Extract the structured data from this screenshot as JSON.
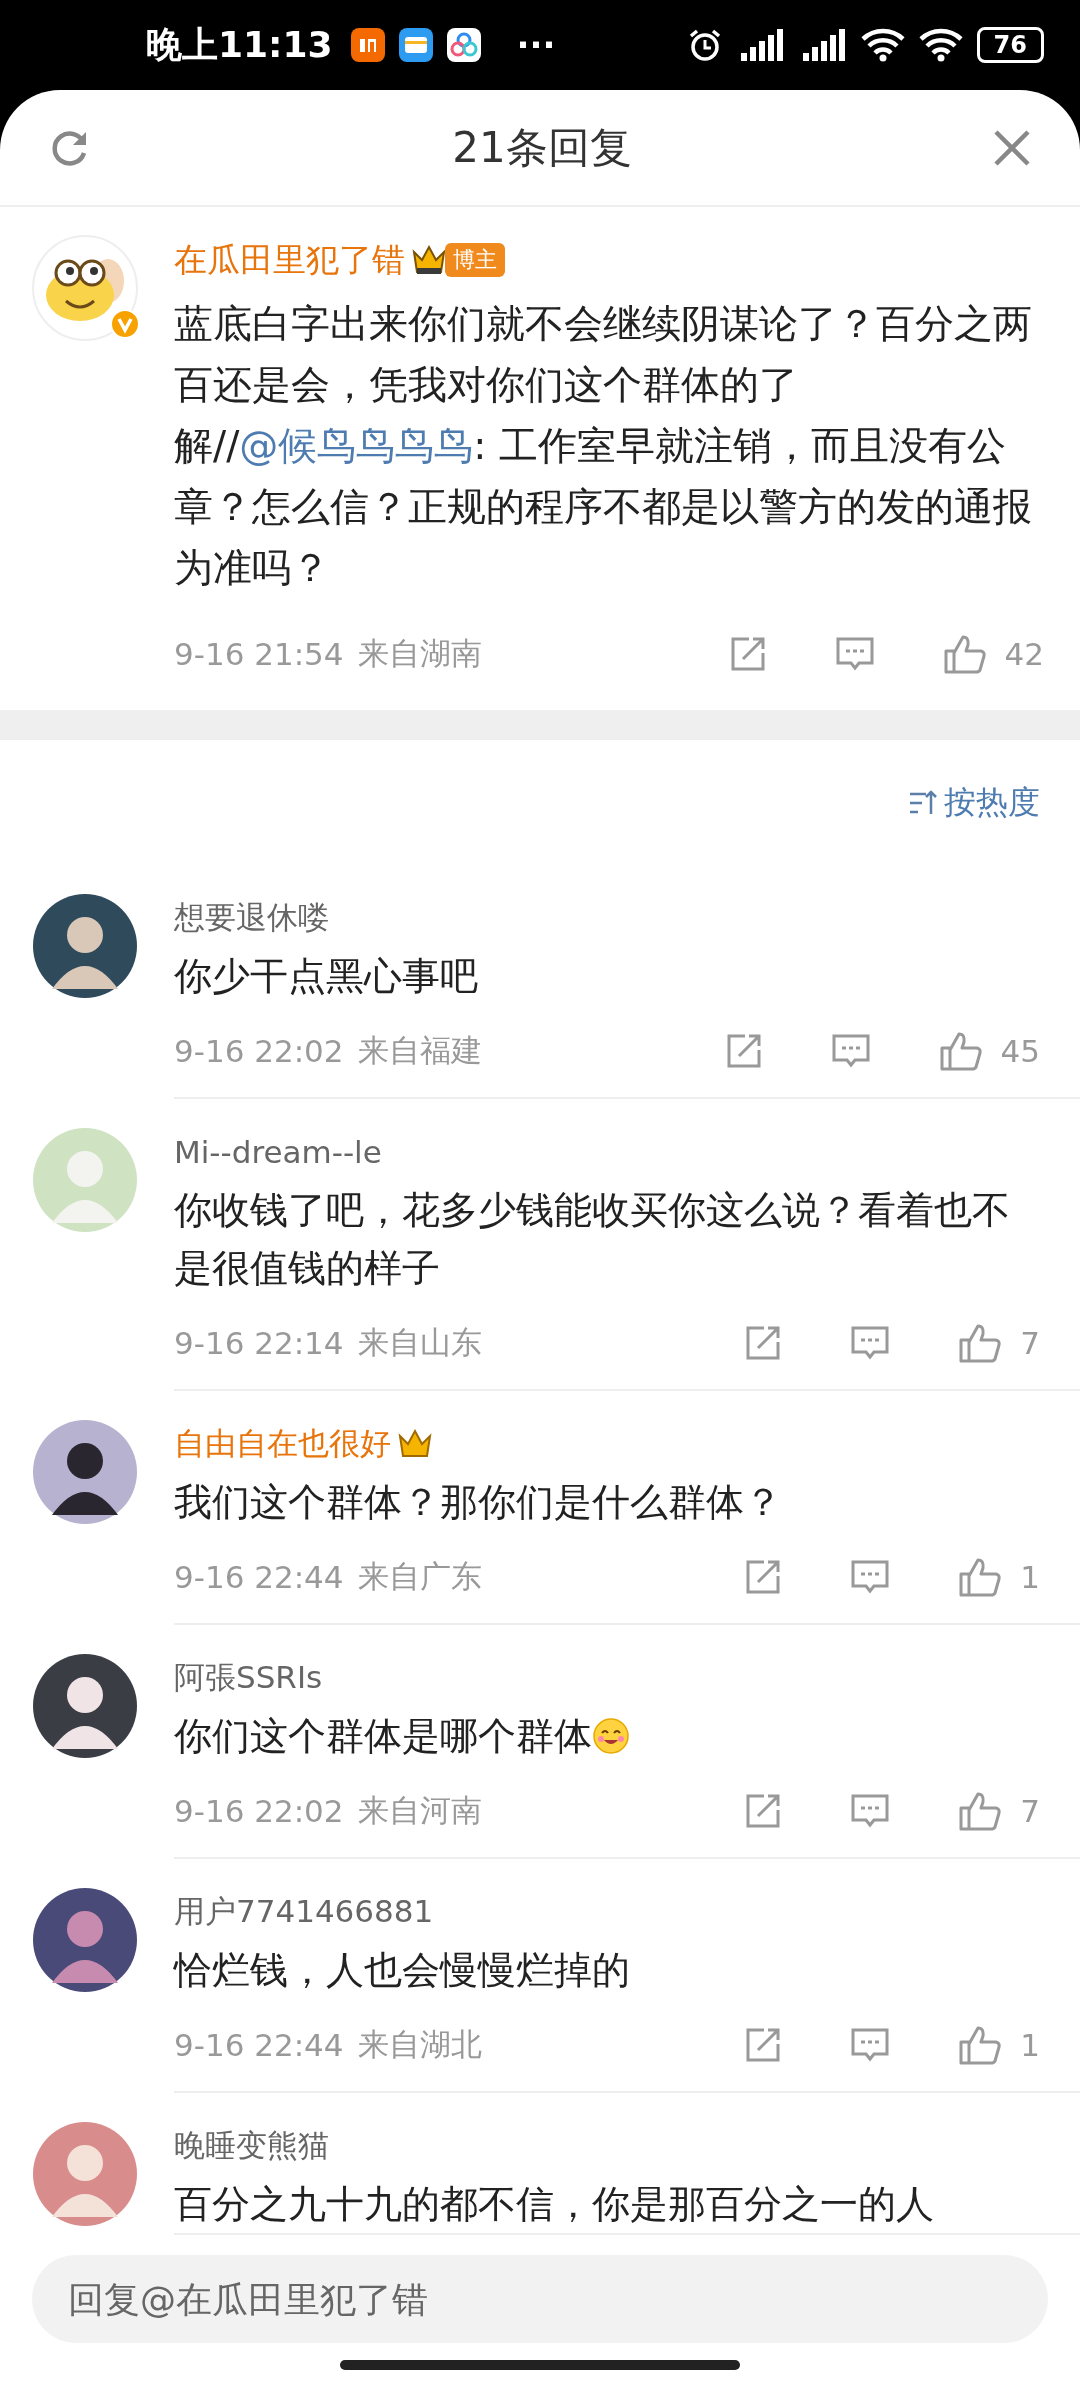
{
  "status_bar": {
    "time": "晚上11:13",
    "more": "···",
    "battery": "76"
  },
  "header": {
    "title": "21条回复"
  },
  "post": {
    "author": "在瓜田里犯了错",
    "vip": true,
    "verified": true,
    "badge": "博主",
    "body": [
      {
        "kind": "text",
        "text": "蓝底白字出来你们就不会继续阴谋论了？百分之两百还是会，凭我对你们这个群体的了解//"
      },
      {
        "kind": "mention",
        "text": "@候鸟鸟鸟鸟"
      },
      {
        "kind": "text",
        "text": ": 工作室早就注销，而且没有公章？怎么信？正规的程序不都是以警方的发的通报为准吗？"
      }
    ],
    "time": "9-16 21:54",
    "location": "来自湖南",
    "likes": "42"
  },
  "sort": {
    "label": "按热度"
  },
  "comments": [
    {
      "author": "想要退休喽",
      "vip": false,
      "body": "你少干点黑心事吧",
      "time": "9-16 22:02",
      "location": "来自福建",
      "likes": "45"
    },
    {
      "author": "Mi--dream--le",
      "vip": false,
      "body": "你收钱了吧，花多少钱能收买你这么说？看着也不是很值钱的样子",
      "time": "9-16 22:14",
      "location": "来自山东",
      "likes": "7"
    },
    {
      "author": "自由自在也很好",
      "vip": true,
      "body": "我们这个群体？那你们是什么群体？",
      "time": "9-16 22:44",
      "location": "来自广东",
      "likes": "1"
    },
    {
      "author": "阿張SSRIs",
      "vip": false,
      "body": "你们这个群体是哪个群体",
      "emoji": true,
      "time": "9-16 22:02",
      "location": "来自河南",
      "likes": "7"
    },
    {
      "author": "用户7741466881",
      "vip": false,
      "body": "恰烂钱，人也会慢慢烂掉的",
      "time": "9-16 22:44",
      "location": "来自湖北",
      "likes": "1"
    },
    {
      "author": "晚睡变熊猫",
      "vip": false,
      "body": "百分之九十九的都不信，你是那百分之一的人"
    }
  ],
  "reply_field": {
    "placeholder": "回复@在瓜田里犯了错"
  }
}
